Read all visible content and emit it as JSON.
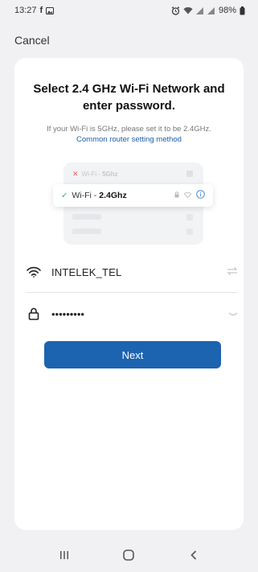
{
  "status_bar": {
    "time": "13:27",
    "battery": "98%"
  },
  "header": {
    "cancel_label": "Cancel"
  },
  "main": {
    "title": "Select 2.4 GHz Wi-Fi Network and enter password.",
    "hint": "If your Wi-Fi is 5GHz, please set it to be 2.4GHz.",
    "hint_link": "Common router setting method",
    "illustration": {
      "row_5g_prefix": "Wi-Fi - ",
      "row_5g_band": "5Ghz",
      "row_24_prefix": "Wi-Fi - ",
      "row_24_band": "2.4Ghz"
    },
    "ssid": {
      "value": "INTELEK_TEL"
    },
    "password": {
      "value": "•••••••••"
    },
    "next_label": "Next"
  },
  "icons": {
    "wifi": "wifi-icon",
    "lock": "lock-icon",
    "switch": "swap-arrows-icon",
    "eye_off": "eye-closed-icon",
    "nav_recent": "recent-apps-icon",
    "nav_home": "home-icon",
    "nav_back": "back-icon"
  },
  "colors": {
    "accent": "#1c63b0",
    "success": "#39b26f",
    "error": "#e8615c",
    "link": "#1d5ea8"
  }
}
